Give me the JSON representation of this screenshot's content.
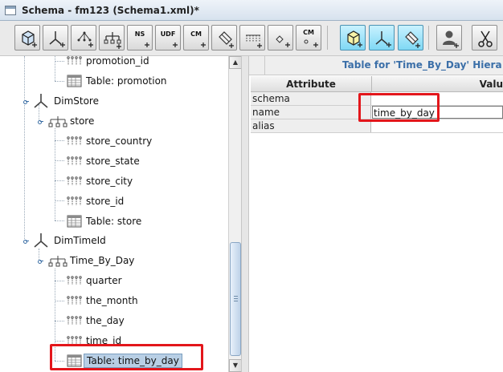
{
  "window": {
    "title": "Schema - fm123 (Schema1.xml)*"
  },
  "toolbar": {
    "buttons": [
      {
        "icon": "add-cube-icon",
        "text": ""
      },
      {
        "icon": "add-dimension-icon",
        "text": ""
      },
      {
        "icon": "add-hierarchy-icon",
        "text": ""
      },
      {
        "icon": "add-level-icon",
        "text": ""
      },
      {
        "icon": "add-named-set-icon",
        "text": "NS"
      },
      {
        "icon": "add-user-defined-function-icon",
        "text": "UDF"
      },
      {
        "icon": "add-calculated-member-icon",
        "text": "CM"
      },
      {
        "icon": "add-measure-icon",
        "text": ""
      },
      {
        "icon": "add-property-icon",
        "text": ""
      },
      {
        "icon": "add-parameter-icon",
        "text": ""
      },
      {
        "icon": "add-member-icon",
        "text": "CM"
      },
      {
        "icon": "add-virtual-cube-icon",
        "text": ""
      },
      {
        "icon": "add-virtual-dimension-icon",
        "text": ""
      },
      {
        "icon": "add-virtual-measure-icon",
        "text": ""
      },
      {
        "icon": "add-role-icon",
        "text": ""
      },
      {
        "icon": "cut-icon",
        "text": ""
      }
    ]
  },
  "tree": {
    "nodes": [
      {
        "label": "promotion_id",
        "icon": "level-icon"
      },
      {
        "label": "Table: promotion",
        "icon": "table-icon"
      },
      {
        "label": "DimStore",
        "icon": "dimension-icon"
      },
      {
        "label": "store",
        "icon": "hierarchy-icon"
      },
      {
        "label": "store_country",
        "icon": "level-icon"
      },
      {
        "label": "store_state",
        "icon": "level-icon"
      },
      {
        "label": "store_city",
        "icon": "level-icon"
      },
      {
        "label": "store_id",
        "icon": "level-icon"
      },
      {
        "label": "Table: store",
        "icon": "table-icon"
      },
      {
        "label": "DimTimeId",
        "icon": "dimension-icon"
      },
      {
        "label": "Time_By_Day",
        "icon": "hierarchy-icon"
      },
      {
        "label": "quarter",
        "icon": "level-icon"
      },
      {
        "label": "the_month",
        "icon": "level-icon"
      },
      {
        "label": "the_day",
        "icon": "level-icon"
      },
      {
        "label": "time_id",
        "icon": "level-icon"
      },
      {
        "label": "Table: time_by_day",
        "icon": "table-icon",
        "selected": true
      }
    ]
  },
  "details": {
    "heading": "Table for 'Time_By_Day' Hiera",
    "columns": [
      "Attribute",
      "Valu"
    ],
    "rows": [
      {
        "attribute": "schema",
        "value": ""
      },
      {
        "attribute": "name",
        "value": "time_by_day"
      },
      {
        "attribute": "alias",
        "value": ""
      }
    ]
  },
  "colors": {
    "highlight_box": "#e3161b",
    "heading": "#3b6fa8",
    "selection": "#b8cfe5"
  }
}
